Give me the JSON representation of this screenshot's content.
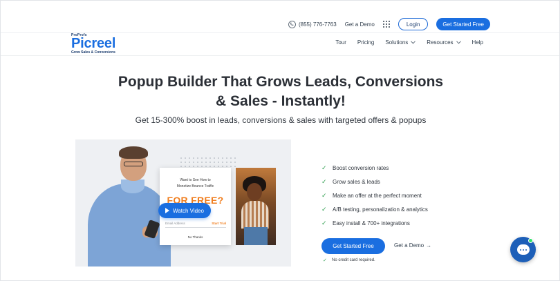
{
  "topbar": {
    "phone": "(855) 776-7763",
    "demo_link": "Get a Demo",
    "login_label": "Login",
    "get_started_label": "Get Started Free"
  },
  "logo": {
    "small_text": "ProProfs",
    "main_text": "Picreel",
    "tagline": "Grow Sales & Conversions"
  },
  "nav": {
    "items": [
      {
        "label": "Tour"
      },
      {
        "label": "Pricing"
      },
      {
        "label": "Solutions"
      },
      {
        "label": "Resources"
      },
      {
        "label": "Help"
      }
    ]
  },
  "hero": {
    "title_line1": "Popup Builder That Grows Leads, Conversions",
    "title_line2": "& Sales - Instantly!",
    "subtitle": "Get 15-300% boost in leads, conversions & sales with targeted offers & popups"
  },
  "illustration": {
    "popup_line1": "Want to See How to",
    "popup_line2": "Monetize Bounce Traffic",
    "popup_offer": "FOR FREE?",
    "popup_email_placeholder": "Email Address",
    "popup_start_label": "Start Trial",
    "popup_dismiss": "No Thanks",
    "watch_video_label": "Watch Video"
  },
  "features": [
    "Boost conversion rates",
    "Grow sales & leads",
    "Make an offer at the perfect moment",
    "A/B testing, personalization & analytics",
    "Easy install & 700+ integrations"
  ],
  "cta": {
    "primary_label": "Get Started Free",
    "demo_label": "Get a Demo",
    "demo_arrow": "→",
    "note": "No credit card required."
  },
  "colors": {
    "accent": "#1a6ee0",
    "check": "#2e9e4f",
    "offer": "#f07d1d",
    "chat_online": "#2ee06a"
  }
}
